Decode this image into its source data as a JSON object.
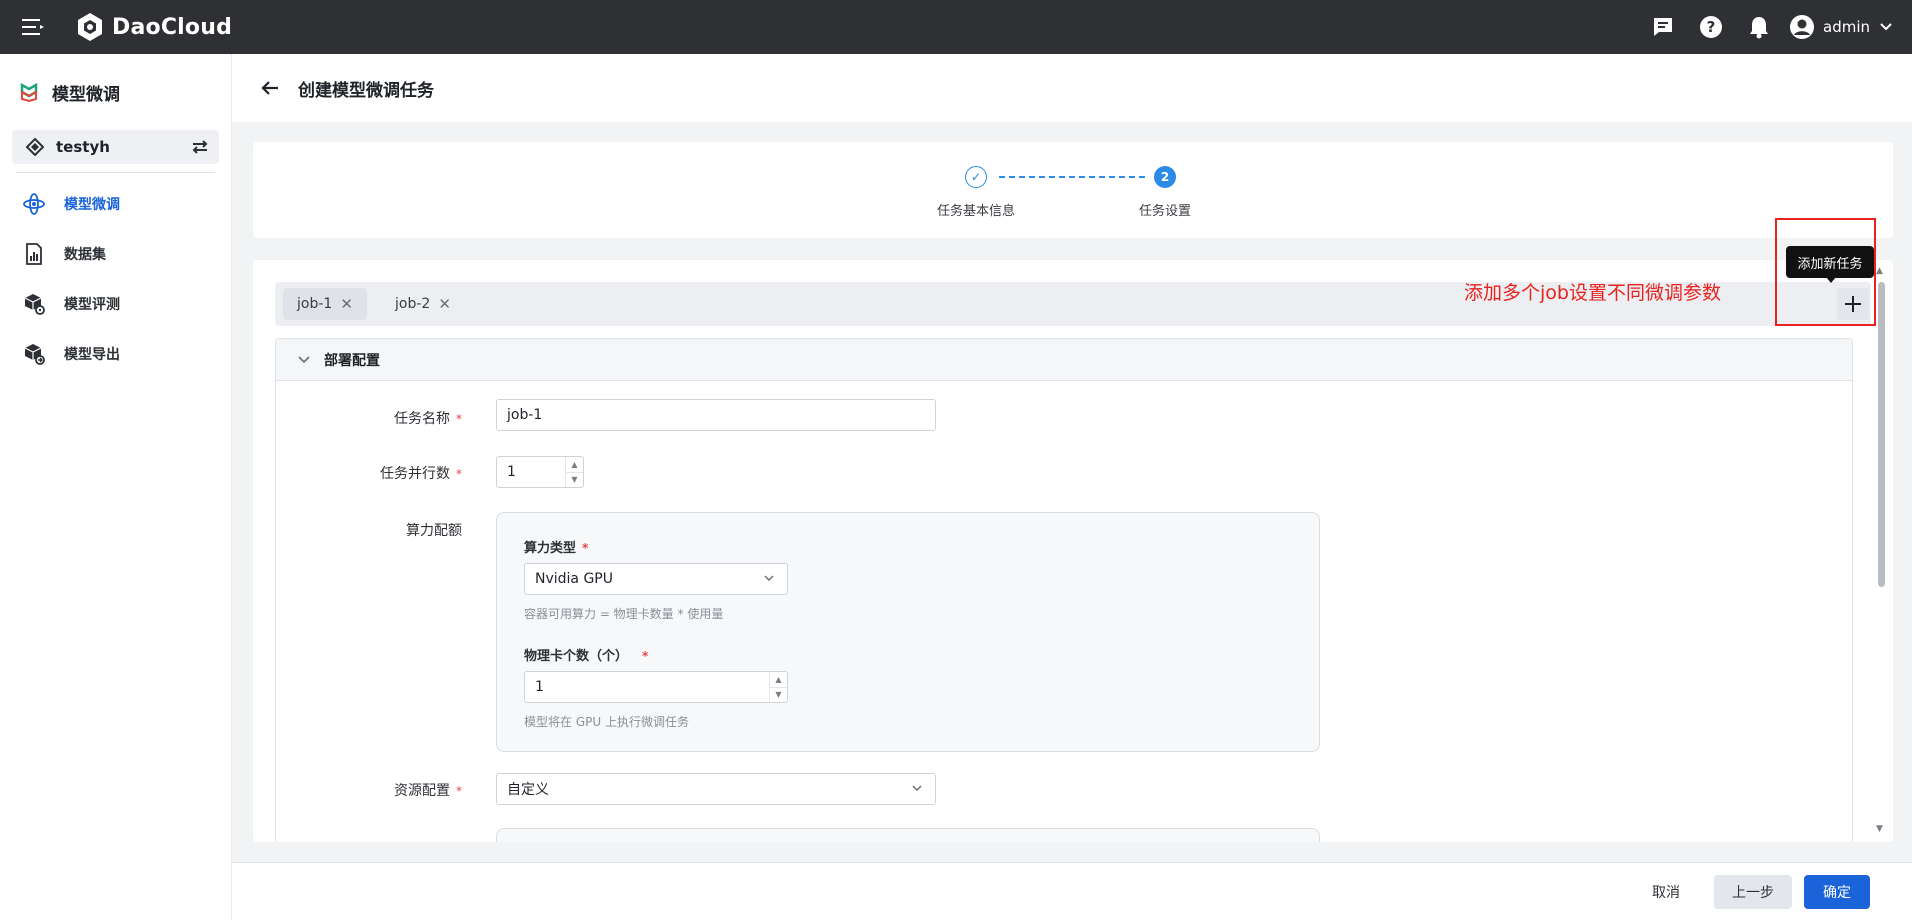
{
  "topbar": {
    "brand": "DaoCloud",
    "user": "admin"
  },
  "sidebar": {
    "title": "模型微调",
    "workspace": "testyh",
    "items": [
      {
        "label": "模型微调",
        "icon": "orbit-icon",
        "active": true
      },
      {
        "label": "数据集",
        "icon": "chart-document-icon",
        "active": false
      },
      {
        "label": "模型评测",
        "icon": "cube-gear-icon",
        "active": false
      },
      {
        "label": "模型导出",
        "icon": "cube-export-icon",
        "active": false
      }
    ]
  },
  "header": {
    "title": "创建模型微调任务"
  },
  "steps": [
    {
      "label": "任务基本信息",
      "status": "done",
      "marker": "✓"
    },
    {
      "label": "任务设置",
      "status": "current",
      "marker": "2"
    }
  ],
  "tabs": {
    "items": [
      {
        "label": "job-1",
        "active": true
      },
      {
        "label": "job-2",
        "active": false
      }
    ],
    "add_tooltip": "添加新任务"
  },
  "annotation": "添加多个job设置不同微调参数",
  "section": {
    "title": "部署配置"
  },
  "form": {
    "task_name_label": "任务名称",
    "task_name_value": "job-1",
    "parallel_label": "任务并行数",
    "parallel_value": "1",
    "quota_label": "算力配额",
    "compute_type_label": "算力类型",
    "compute_type_value": "Nvidia GPU",
    "compute_hint": "容器可用算力 = 物理卡数量 * 使用量",
    "card_count_label": "物理卡个数（个）",
    "card_count_value": "1",
    "card_hint": "模型将在 GPU 上执行微调任务",
    "resource_label": "资源配置",
    "resource_value": "自定义"
  },
  "footer": {
    "cancel": "取消",
    "prev": "上一步",
    "confirm": "确定"
  },
  "colors": {
    "primary": "#1a63d8",
    "step_blue": "#2b8be6",
    "annotation_red": "#e8231f",
    "topbar": "#2f3033"
  }
}
